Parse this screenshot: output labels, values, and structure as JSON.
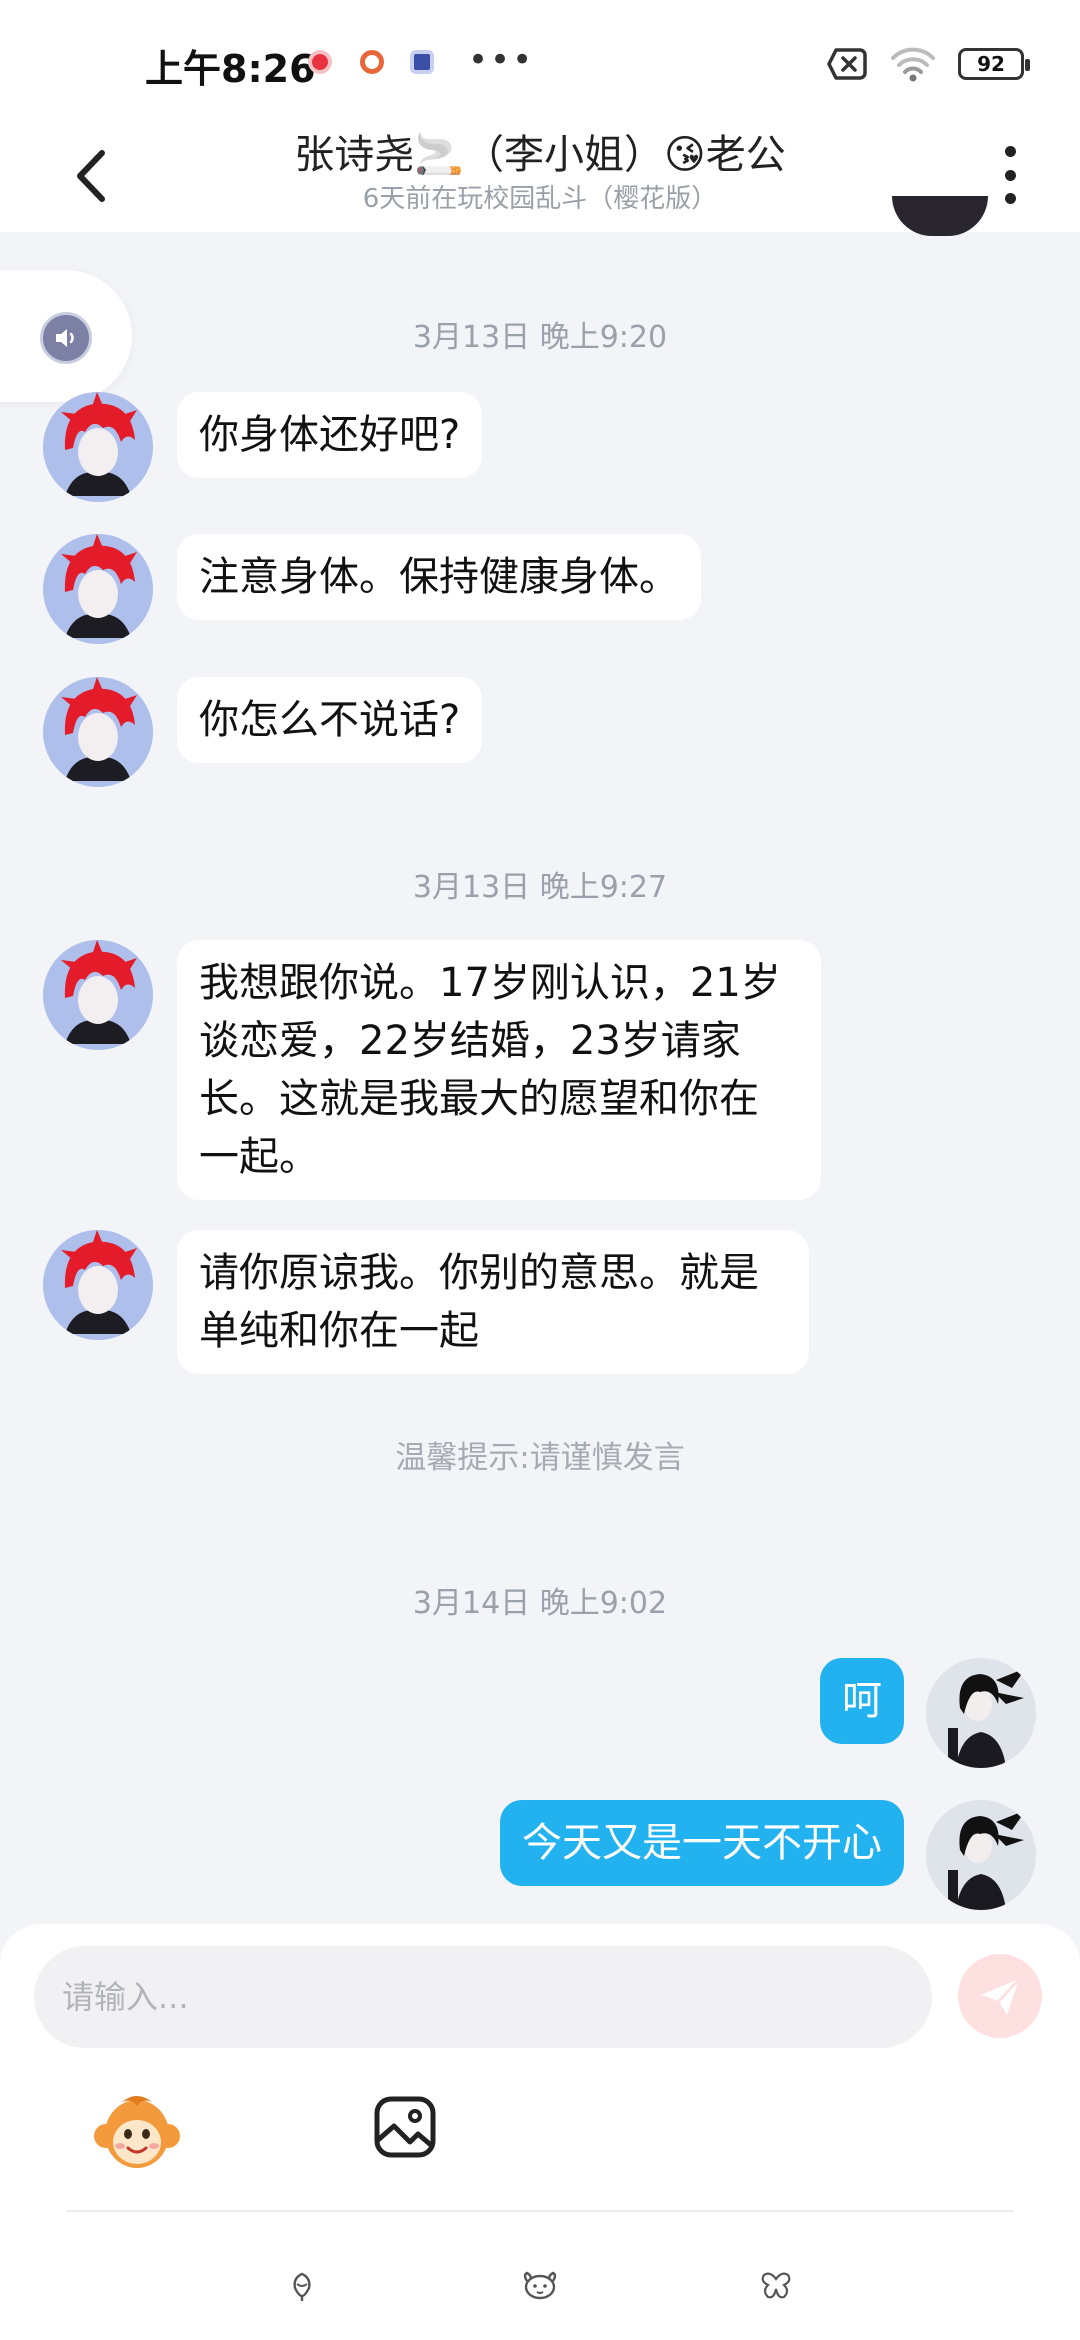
{
  "status_bar": {
    "time": "上午8:26",
    "dots": "•••",
    "battery": "92"
  },
  "header": {
    "title": "张诗尧🚬（李小姐）😘老公",
    "subtitle": "6天前在玩校园乱斗（樱花版）"
  },
  "messages": {
    "ts1": "3月13日 晚上9:20",
    "m1": "你身体还好吧?",
    "m2": "注意身体。保持健康身体。",
    "m3": "你怎么不说话?",
    "ts2": "3月13日 晚上9:27",
    "m4_lines": [
      "我想跟你说。17岁刚认识，21岁",
      "谈恋爱，22岁结婚，23岁请家",
      "长。这就是我最大的愿望和你在",
      "一起。"
    ],
    "m5_lines": [
      "请你原谅我。你别的意思。就是",
      "单纯和你在一起"
    ],
    "hint": "温馨提示:请谨慎发言",
    "ts3": "3月14日 晚上9:02",
    "m6": "呵",
    "m7": "今天又是一天不开心"
  },
  "input": {
    "placeholder": "请输入..."
  },
  "colors": {
    "background": "#f2f4f8",
    "bubble_self": "#22b2f0",
    "bubble_other": "#ffffff",
    "send_button": "#fde1e1"
  },
  "icons": [
    "back-arrow-icon",
    "more-vertical-icon",
    "speaker-icon",
    "monkey-emoji-icon",
    "image-icon",
    "send-icon",
    "flower-nav-icon",
    "dog-face-nav-icon",
    "butterfly-nav-icon"
  ]
}
